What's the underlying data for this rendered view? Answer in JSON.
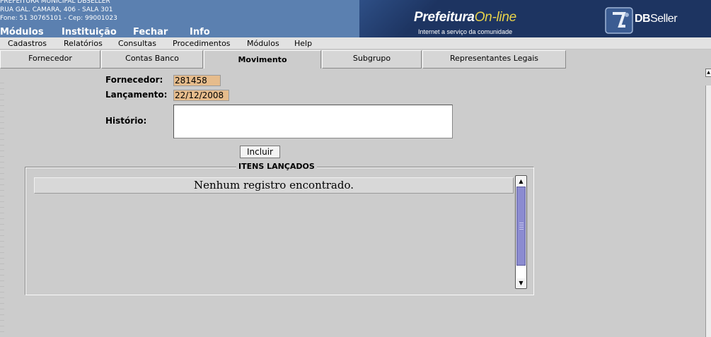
{
  "header": {
    "org_name": "PREFEITURA MUNICIPAL DBSELLER",
    "address": "RUA GAL. CAMARA, 406 - SALA 301",
    "phone": "Fone: 51 30765101  -  Cep: 99001023",
    "menu": [
      "Módulos",
      "Instituição",
      "Fechar",
      "Info"
    ],
    "brand_title": "Prefeitura",
    "brand_online": "On-line",
    "brand_subtitle": "Internet a serviço da comunidade",
    "vendor_bold": "DB",
    "vendor_rest": "Seller",
    "colors": {
      "header_bg": "#5b80b0",
      "brand_bg": "#1d3461",
      "online_accent": "#e8d24a"
    }
  },
  "menubar": [
    "Cadastros",
    "Relatórios",
    "Consultas",
    "Procedimentos",
    "Módulos",
    "Help"
  ],
  "tabs": [
    {
      "label": "Fornecedor",
      "active": false
    },
    {
      "label": "Contas Banco",
      "active": false
    },
    {
      "label": "Movimento",
      "active": true
    },
    {
      "label": "Subgrupo",
      "active": false
    },
    {
      "label": "Representantes Legais",
      "active": false
    }
  ],
  "form": {
    "fornecedor_label": "Fornecedor:",
    "fornecedor_value": "281458",
    "lancamento_label": "Lançamento:",
    "lancamento_value": "22/12/2008",
    "historico_label": "Histório:",
    "historico_value": "",
    "incluir_label": "Incluir",
    "input_readonly_color": "#e6bc8c"
  },
  "itens": {
    "legend": "ITENS LANÇADOS",
    "empty_message": "Nenhum registro encontrado."
  }
}
